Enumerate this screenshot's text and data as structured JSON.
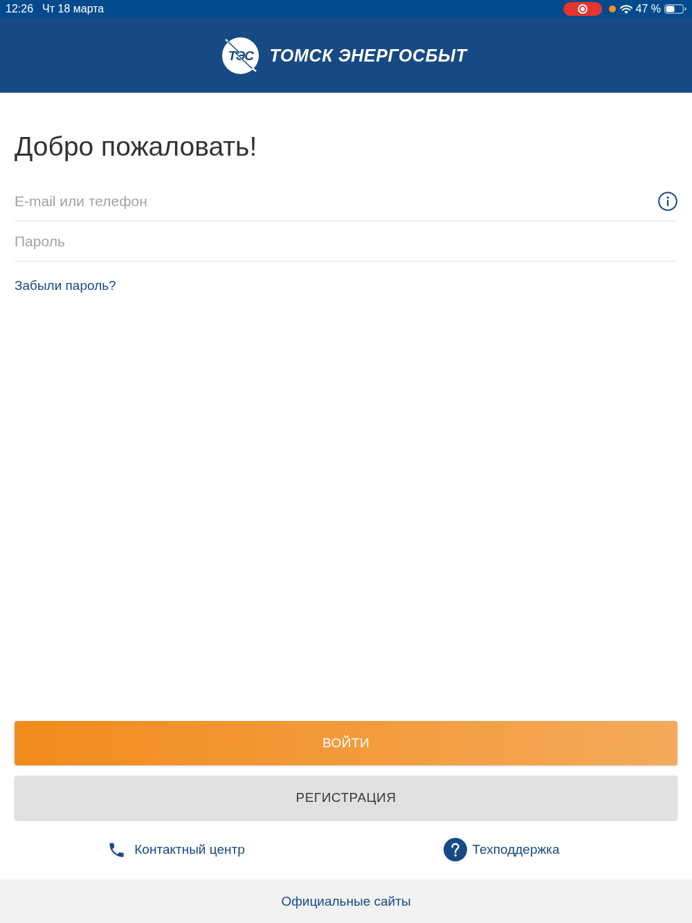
{
  "status_bar": {
    "time": "12:26",
    "date": "Чт 18 марта",
    "recording": true,
    "battery": "47 %"
  },
  "header": {
    "logo_mark": "ТЭС",
    "brand": "ТОМСК ЭНЕРГОСБЫТ"
  },
  "title": "Добро пожаловать!",
  "fields": [
    {
      "placeholder": "E-mail или телефон",
      "info": true
    },
    {
      "placeholder": "Пароль",
      "info": false
    }
  ],
  "forgot_link": "Забыли пароль?",
  "buttons": [
    {
      "kind": "primary",
      "label": "ВОЙТИ"
    },
    {
      "kind": "secondary",
      "label": "РЕГИСТРАЦИЯ"
    }
  ],
  "help_links": [
    {
      "kind": "phone",
      "label": "Контактный центр"
    },
    {
      "kind": "question",
      "label": "Техподдержка"
    }
  ],
  "footer_link": "Официальные сайты"
}
